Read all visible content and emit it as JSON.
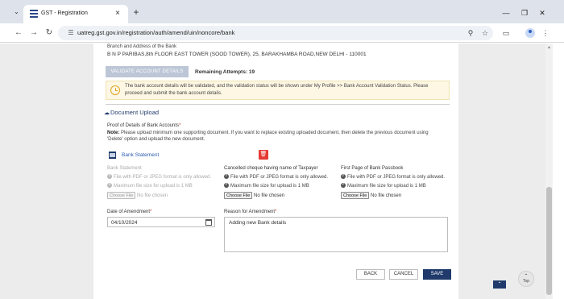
{
  "browser": {
    "tab_title": "GST - Registration",
    "url": "uatreg.gst.gov.in/registration/auth/amend/uin/noncore/bank",
    "icons": {
      "tab_menu": "chevron-down-icon",
      "back": "arrow-left-icon",
      "forward": "arrow-right-icon",
      "reload": "reload-icon",
      "site_info": "tune-icon",
      "zoom": "magnifier-icon",
      "bookmark": "star-icon",
      "extensions": "puzzle-icon",
      "profile": "profile-icon",
      "menu": "kebab-menu-icon"
    }
  },
  "bank": {
    "branch_label": "Branch and Address of the Bank",
    "branch_value": "B N P PARIBAS,8th FLOOR EAST TOWER (SOOD TOWER), 25, BARAKHAMBA ROAD,NEW DELHI - 110001",
    "validate_button": "VALIDATE ACCOUNT DETAILS",
    "remaining_attempts": "Remaining Attempts: 19",
    "info_line1": "The bank account details will be validated, and the validation status will be shown under My Profile >> Bank Account Validation Status. Please",
    "info_line2": "proceed and submit the bank account details."
  },
  "upload": {
    "heading": "Document Upload",
    "proof_label": "Proof of Details of Bank Accounts",
    "required_mark": "*",
    "note_prefix": "Note:",
    "note_line1": " Please upload minimum one supporting document. If you want to replace existing uploaded document, then delete the previous document using",
    "note_line2": "'Delete' option and upload the new document.",
    "uploaded_file": "Bank Statement",
    "columns": [
      {
        "head": "Bank Statement",
        "note1": "File with PDF or JPEG format is only allowed.",
        "note2": "Maximum file size for upload is 1 MB",
        "choose": "Choose File",
        "status": "No file chosen"
      },
      {
        "head": "Cancelled cheque having name of Taxpayer",
        "note1": "File with PDF or JPEG format is only allowed.",
        "note2": "Maximum file size for upload is 1 MB",
        "choose": "Choose File",
        "status": "No file chosen"
      },
      {
        "head": "First Page of Bank Passbook",
        "note1": "File with PDF or JPEG format is only allowed.",
        "note2": "Maximum file size for upload is 1 MB",
        "choose": "Choose File",
        "status": "No file chosen"
      }
    ]
  },
  "amendment": {
    "date_label": "Date of Amendment",
    "date_value": "04/10/2024",
    "reason_label": "Reason for Amendment",
    "reason_value": "Adding new Bank details",
    "required_mark": "*"
  },
  "actions": {
    "back": "BACK",
    "cancel": "CANCEL",
    "save": "SAVE"
  },
  "scroll_top": {
    "label": "Top"
  },
  "colors": {
    "primary_navy": "#1f3a6b",
    "delete_red": "#e53935",
    "info_bg": "#fdf7e3",
    "link_blue": "#2a5bb0"
  }
}
